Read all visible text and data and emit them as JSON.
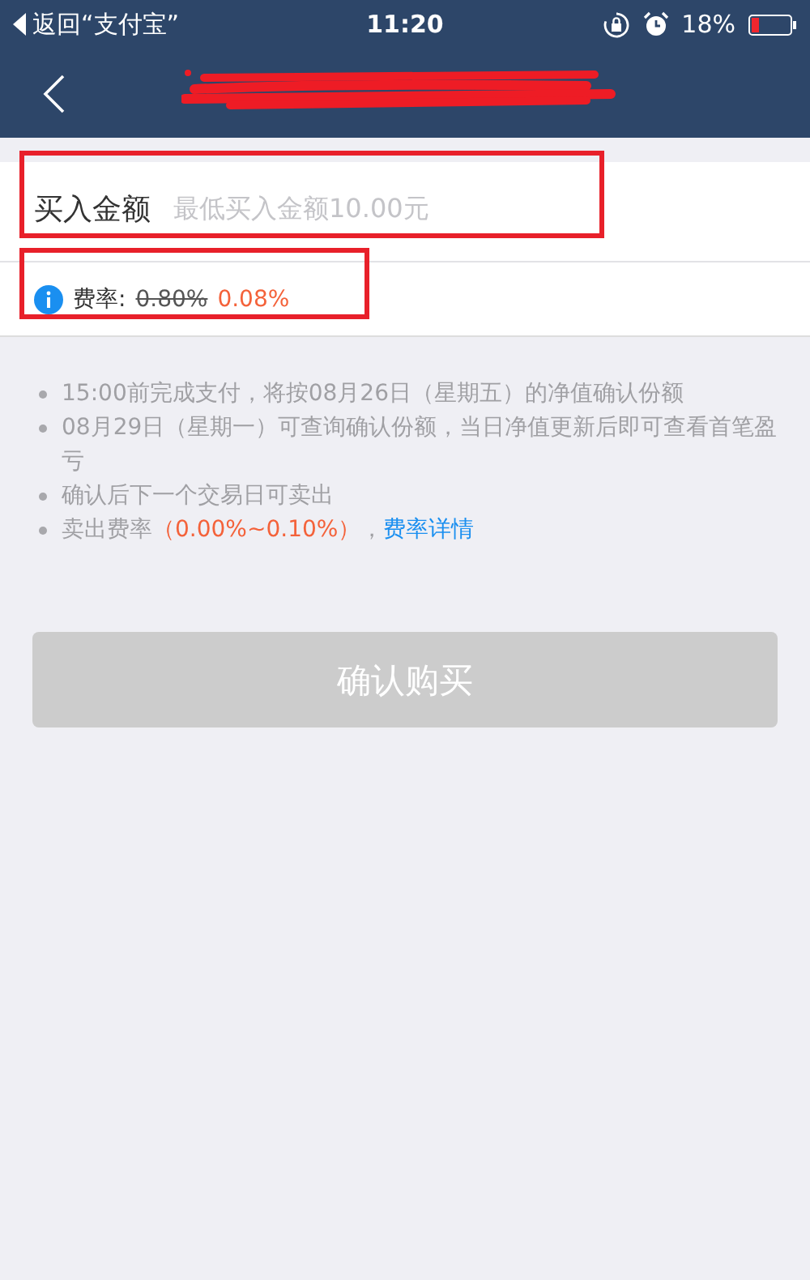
{
  "status_bar": {
    "back_app": "返回“支付宝”",
    "time": "11:20",
    "battery_text": "18%"
  },
  "amount_field": {
    "label": "买入金额",
    "placeholder": "最低买入金额10.00元"
  },
  "fee": {
    "label": "费率:",
    "original_rate": "0.80%",
    "discount_rate": "0.08%"
  },
  "notes": [
    {
      "kind": "plain",
      "text": "15:00前完成支付，将按08月26日（星期五）的净值确认份额"
    },
    {
      "kind": "plain",
      "text": "08月29日（星期一）可查询确认份额，当日净值更新后即可查看首笔盈亏"
    },
    {
      "kind": "plain",
      "text": "确认后下一个交易日可卖出"
    },
    {
      "kind": "fee",
      "text": "卖出费率",
      "rate": "（0.00%~0.10%）",
      "separator": "，",
      "link": "费率详情"
    }
  ],
  "confirm_button": {
    "label": "确认购买",
    "disabled": true
  }
}
